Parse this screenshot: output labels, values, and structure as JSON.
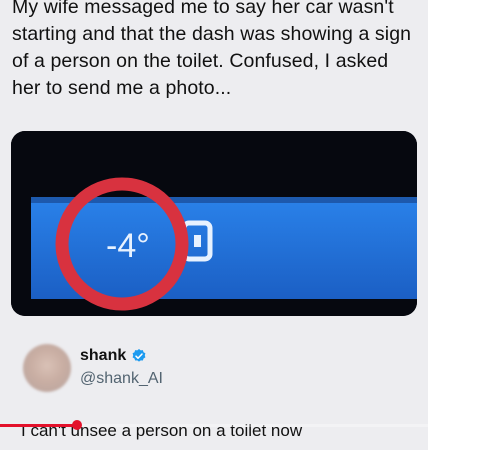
{
  "post": {
    "text": "My wife messaged me to say her car wasn't starting and that the dash was showing a sign of a person on the toilet. Confused, I asked her to send me a photo..."
  },
  "photo": {
    "dash_reading": "-4°"
  },
  "reply": {
    "name": "shank",
    "handle": "@shank_AI",
    "text": "I can't unsee a person on a toilet now"
  },
  "player": {
    "progress_fraction": 0.18
  },
  "colors": {
    "accent_red": "#e3112b",
    "verified_blue": "#1d9bf0",
    "dash_blue": "#1e6fd9"
  },
  "icons": {
    "verified": "verified-badge-icon",
    "dash_symbol": "seatbelt-warning-icon"
  }
}
